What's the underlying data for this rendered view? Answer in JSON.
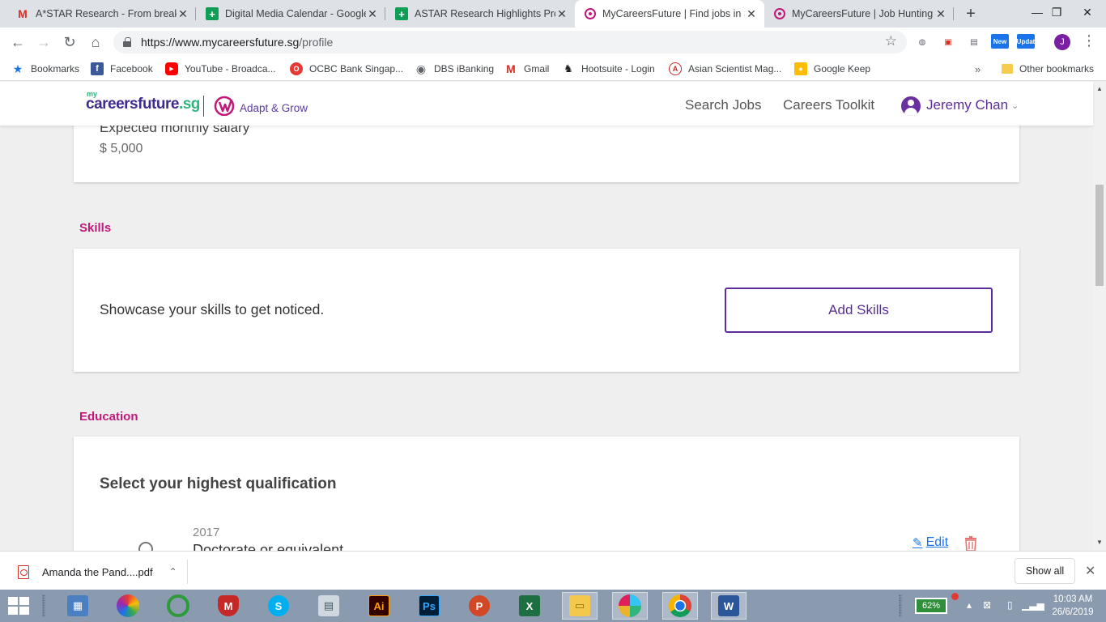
{
  "browser": {
    "tabs": [
      {
        "title": "A*STAR Research - From breakthr",
        "favicon": "gmail-icon"
      },
      {
        "title": "Digital Media Calendar - Google S",
        "favicon": "sheets-icon"
      },
      {
        "title": "ASTAR Research Highlights Proje",
        "favicon": "sheets-icon"
      },
      {
        "title": "MyCareersFuture | Find jobs in Si",
        "favicon": "mycareersfuture-icon",
        "active": true
      },
      {
        "title": "MyCareersFuture | Job Hunting",
        "favicon": "mycareersfuture-icon"
      }
    ],
    "url_host": "https://www.mycareersfuture.sg",
    "url_path": "/profile",
    "extensions": {
      "new_label": "New",
      "update_label": "Updat"
    },
    "profile_initial": "J"
  },
  "bookmarks": {
    "items": [
      {
        "label": "Bookmarks",
        "icon": "star-icon"
      },
      {
        "label": "Facebook",
        "icon": "facebook-icon"
      },
      {
        "label": "YouTube - Broadca...",
        "icon": "youtube-icon"
      },
      {
        "label": "OCBC Bank Singap...",
        "icon": "ocbc-icon"
      },
      {
        "label": "DBS iBanking",
        "icon": "dbs-icon"
      },
      {
        "label": "Gmail",
        "icon": "gmail-icon"
      },
      {
        "label": "Hootsuite - Login",
        "icon": "hootsuite-icon"
      },
      {
        "label": "Asian Scientist Mag...",
        "icon": "asian-scientist-icon"
      },
      {
        "label": "Google Keep",
        "icon": "keep-icon"
      }
    ],
    "more": "»",
    "other": "Other bookmarks"
  },
  "site": {
    "logo_my": "my",
    "logo_careers": "careersfuture",
    "logo_sg": ".sg",
    "adapt_grow": "Adapt & Grow",
    "nav": {
      "search_jobs": "Search Jobs",
      "careers_toolkit": "Careers Toolkit"
    },
    "user": {
      "name": "Jeremy Chan"
    }
  },
  "profile": {
    "salary": {
      "label": "Expected monthly salary",
      "value": "$ 5,000"
    },
    "skills": {
      "title": "Skills",
      "prompt": "Showcase your skills to get noticed.",
      "button": "Add Skills"
    },
    "education": {
      "title": "Education",
      "heading": "Select your highest qualification",
      "entry": {
        "year": "2017",
        "name": "Doctorate or equivalent"
      },
      "edit_label": "Edit"
    }
  },
  "downloads": {
    "file": "Amanda the Pand....pdf",
    "show_all": "Show all"
  },
  "taskbar": {
    "battery": "62%",
    "time": "10:03 AM",
    "date": "26/6/2019",
    "apps": {
      "illustrator": "Ai",
      "photoshop": "Ps",
      "powerpoint": "P",
      "excel": "X",
      "word": "W",
      "skype": "S",
      "mcafee": "M"
    }
  },
  "colors": {
    "brand_purple": "#5b2d9a",
    "brand_magenta": "#c2187a",
    "brand_green": "#2eb67d",
    "link_blue": "#1a73e8"
  }
}
